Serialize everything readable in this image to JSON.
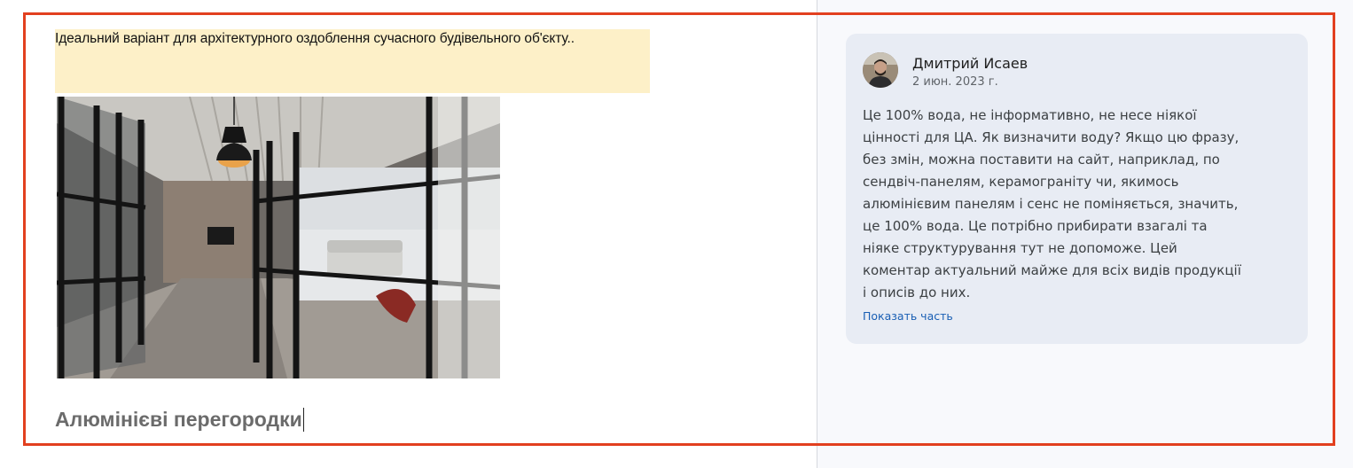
{
  "document": {
    "highlighted_text": "Ідеальний варіант для архітектурного оздоблення сучасного будівельного об'єкту..",
    "heading": "Алюмінієві перегородки"
  },
  "comment": {
    "author": "Дмитрий Исаев",
    "date": "2 июн. 2023 г.",
    "body_lines": [
      "Це 100% вода, не інформативно, не несе ніякої",
      "цінності для ЦА. Як визначити воду? Якщо цю фразу,",
      "без змін, можна поставити на сайт, наприклад, по",
      "сендвіч-панелям, керамограніту чи, якимось",
      "алюмінієвим панелям і сенс не поміняється, значить,",
      "це 100% вода. Це потрібно прибирати взагалі та",
      "ніяке структурування тут не допоможе. Цей",
      "коментар актуальний майже для всіх видів продукції",
      "і описів до них."
    ],
    "show_more_label": "Показать часть"
  },
  "colors": {
    "highlight": "#fdf0c8",
    "frame": "#e2401f",
    "card": "#e8ecf4",
    "link": "#1a5fb4"
  }
}
